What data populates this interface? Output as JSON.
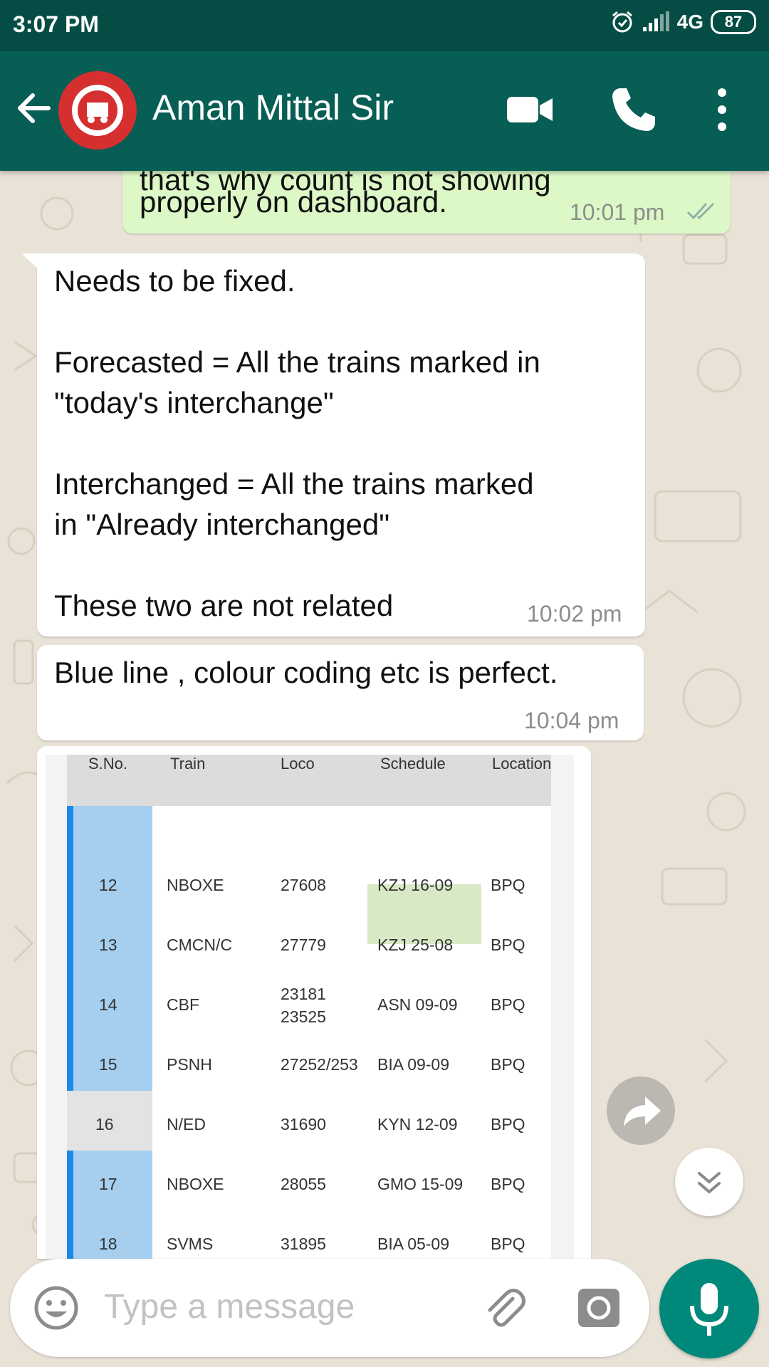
{
  "status_bar": {
    "time": "3:07 PM",
    "network": "4G",
    "battery": "87"
  },
  "header": {
    "contact_name": "Aman Mittal Sir",
    "colors": {
      "header": "#075e54",
      "status": "#054d44",
      "outgoing": "#dcf8c6",
      "accent": "#00897b"
    },
    "icons": [
      "back-arrow-icon",
      "video-call-icon",
      "voice-call-icon",
      "more-options-icon"
    ]
  },
  "messages": [
    {
      "type": "outgoing",
      "text_partial": "that's why count is not showing",
      "text": "properly on dashboard.",
      "time": "10:01 pm",
      "status": "read"
    },
    {
      "type": "incoming",
      "text": "Needs to be fixed.\n\nForecasted = All the trains marked in\n\"today's interchange\"\n\nInterchanged = All the trains marked\nin \"Already interchanged\"\n\nThese two are not related",
      "time": "10:02 pm"
    },
    {
      "type": "incoming",
      "text": "Blue line , colour coding etc is perfect.",
      "time": "10:04 pm"
    }
  ],
  "image_message": {
    "columns": [
      "S.No.",
      "Train",
      "Loco",
      "Schedule",
      "Location"
    ],
    "rows": [
      {
        "sno": "12",
        "train": "NBOXE",
        "loco": "27608",
        "schedule": "KZJ 16-09",
        "location": "BPQ"
      },
      {
        "sno": "13",
        "train": "CMCN/C",
        "loco": "27779",
        "schedule": "KZJ 25-08",
        "location": "BPQ"
      },
      {
        "sno": "14",
        "train": "CBF",
        "loco": "23181\n23525",
        "schedule": "ASN 09-09",
        "location": "BPQ"
      },
      {
        "sno": "15",
        "train": "PSNH",
        "loco": "27252/253",
        "schedule": "BIA 09-09",
        "location": "BPQ"
      },
      {
        "sno": "16",
        "train": "N/ED",
        "loco": "31690",
        "schedule": "KYN 12-09",
        "location": "BPQ"
      },
      {
        "sno": "17",
        "train": "NBOXE",
        "loco": "28055",
        "schedule": "GMO 15-09",
        "location": "BPQ"
      },
      {
        "sno": "18",
        "train": "SVMS",
        "loco": "31895",
        "schedule": "BIA 05-09",
        "location": "BPQ"
      }
    ]
  },
  "input": {
    "placeholder": "Type a message"
  }
}
